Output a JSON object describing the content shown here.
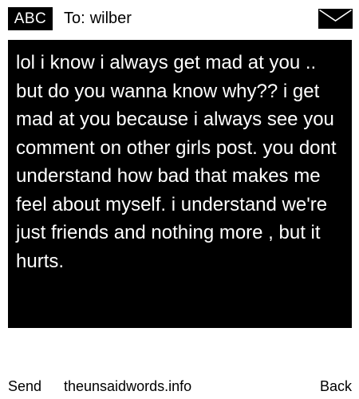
{
  "header": {
    "badge_label": "ABC",
    "to_prefix": "To:",
    "recipient": "wilber",
    "envelope_icon": "envelope-icon"
  },
  "message": {
    "body": "lol i know i always get mad at you .. but do you wanna know why?? i get mad at you because i always see you comment on other girls post. you dont understand how bad that makes me feel about myself. i understand we're just friends and nothing more , but it hurts."
  },
  "footer": {
    "send_label": "Send",
    "site_label": "theunsaidwords.info",
    "back_label": "Back"
  },
  "colors": {
    "background": "#ffffff",
    "panel": "#000000",
    "panel_text": "#ffffff"
  }
}
